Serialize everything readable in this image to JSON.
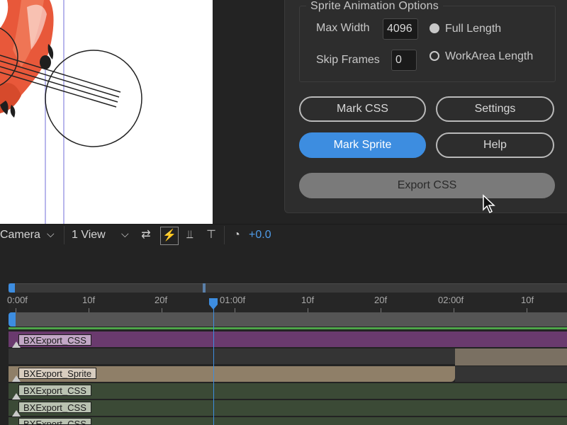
{
  "panel": {
    "group_title": "Sprite Animation Options",
    "max_width_label": "Max Width",
    "max_width_value": "4096",
    "skip_frames_label": "Skip Frames",
    "skip_frames_value": "0",
    "radio_full_length": "Full Length",
    "radio_workarea_length": "WorkArea Length",
    "selected_radio": "Full Length",
    "buttons": {
      "mark_css": "Mark CSS",
      "settings": "Settings",
      "mark_sprite": "Mark Sprite",
      "help": "Help",
      "export_css": "Export CSS"
    }
  },
  "toolbar": {
    "camera": "Camera",
    "view": "1 View",
    "exposure": "+0.0"
  },
  "timeline": {
    "ticks": [
      "0:00f",
      "10f",
      "20f",
      "01:00f",
      "10f",
      "20f",
      "02:00f",
      "10f"
    ],
    "current_time": "01:00f",
    "layers": [
      {
        "name": "BXExport_CSS",
        "color": "#6a3a6e"
      },
      {
        "name": "BXExport_Sprite",
        "color": "#8f7f68"
      },
      {
        "name": "BXExport_CSS",
        "color": "#3b4a36"
      },
      {
        "name": "BXExport_CSS",
        "color": "#3b4a36"
      },
      {
        "name": "BXExport_CSS",
        "color": "#3b4a36"
      }
    ]
  },
  "colors": {
    "accent": "#3d8de0",
    "green_bar": "#4ea54a"
  }
}
